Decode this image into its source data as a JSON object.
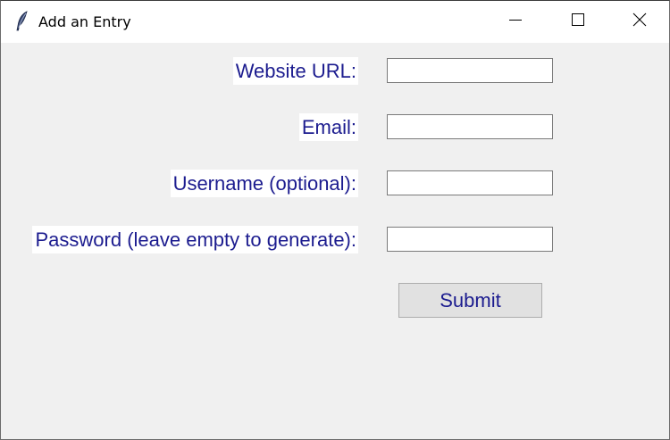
{
  "window": {
    "title": "Add an Entry",
    "icon": "feather-icon",
    "controls": [
      "minimize-icon",
      "maximize-icon",
      "close-icon"
    ]
  },
  "form": {
    "website_url_label": "Website URL:",
    "email_label": "Email:",
    "username_label": "Username (optional):",
    "password_label": "Password (leave empty to generate):",
    "website_url_value": "",
    "email_value": "",
    "username_value": "",
    "password_value": "",
    "submit_label": "Submit"
  },
  "colors": {
    "label_text": "#1c1c8f",
    "window_bg": "#f0f0f0",
    "titlebar_bg": "#ffffff"
  }
}
